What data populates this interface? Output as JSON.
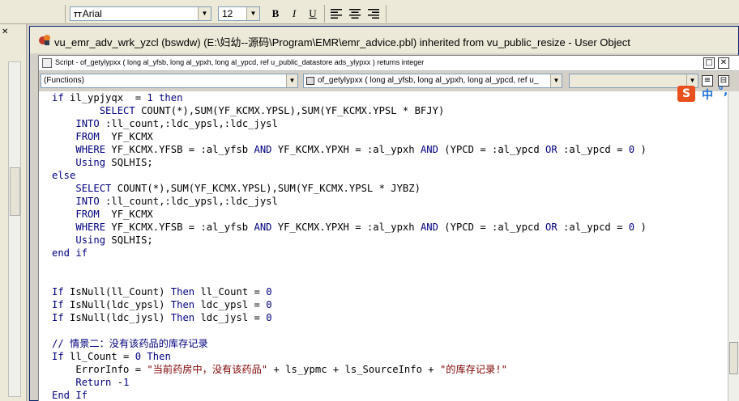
{
  "toolbar": {
    "font_icon": "TT",
    "font_name": "Arial",
    "font_size": "12",
    "bold": "B",
    "italic": "I",
    "underline": "U"
  },
  "window": {
    "title": "vu_emr_adv_wrk_yzcl (bswdw) (E:\\妇幼--源码\\Program\\EMR\\emr_advice.pbl) inherited from vu_public_resize - User Object"
  },
  "script_window": {
    "title": "Script - of_getylypxx ( long al_yfsb, long al_ypxh, long al_ypcd, ref u_public_datastore ads_ylypxx ) returns integer",
    "functions_select": "(Functions)",
    "signature_select": "of_getylypxx ( long al_yfsb, long al_ypxh, long al_ypcd, ref u_"
  },
  "ime": {
    "logo": "S",
    "label": "中"
  },
  "code_lines": [
    [
      [
        "kw",
        "if "
      ],
      [
        "t",
        "il_ypjyqx  = "
      ],
      [
        "num",
        "1"
      ],
      [
        "kw",
        " then"
      ]
    ],
    [
      [
        "t",
        "        "
      ],
      [
        "kw",
        "SELECT"
      ],
      [
        "t",
        " COUNT(*),SUM(YF_KCMX.YPSL),SUM(YF_KCMX.YPSL * BFJY)"
      ]
    ],
    [
      [
        "t",
        "    "
      ],
      [
        "kw",
        "INTO"
      ],
      [
        "t",
        " :ll_count,:ldc_ypsl,:ldc_jysl"
      ]
    ],
    [
      [
        "t",
        "    "
      ],
      [
        "kw",
        "FROM"
      ],
      [
        "t",
        "  YF_KCMX"
      ]
    ],
    [
      [
        "t",
        "    "
      ],
      [
        "kw",
        "WHERE"
      ],
      [
        "t",
        " YF_KCMX.YFSB = :al_yfsb "
      ],
      [
        "kw",
        "AND"
      ],
      [
        "t",
        " YF_KCMX.YPXH = :al_ypxh "
      ],
      [
        "kw",
        "AND"
      ],
      [
        "t",
        " (YPCD = :al_ypcd "
      ],
      [
        "kw",
        "OR"
      ],
      [
        "t",
        " :al_ypcd = "
      ],
      [
        "num",
        "0"
      ],
      [
        "t",
        " )"
      ]
    ],
    [
      [
        "t",
        "    "
      ],
      [
        "kw",
        "Using"
      ],
      [
        "t",
        " SQLHIS;"
      ]
    ],
    [
      [
        "kw",
        "else"
      ]
    ],
    [
      [
        "t",
        "    "
      ],
      [
        "kw",
        "SELECT"
      ],
      [
        "t",
        " COUNT(*),SUM(YF_KCMX.YPSL),SUM(YF_KCMX.YPSL * JYBZ)"
      ]
    ],
    [
      [
        "t",
        "    "
      ],
      [
        "kw",
        "INTO"
      ],
      [
        "t",
        " :ll_count,:ldc_ypsl,:ldc_jysl"
      ]
    ],
    [
      [
        "t",
        "    "
      ],
      [
        "kw",
        "FROM"
      ],
      [
        "t",
        "  YF_KCMX"
      ]
    ],
    [
      [
        "t",
        "    "
      ],
      [
        "kw",
        "WHERE"
      ],
      [
        "t",
        " YF_KCMX.YFSB = :al_yfsb "
      ],
      [
        "kw",
        "AND"
      ],
      [
        "t",
        " YF_KCMX.YPXH = :al_ypxh "
      ],
      [
        "kw",
        "AND"
      ],
      [
        "t",
        " (YPCD = :al_ypcd "
      ],
      [
        "kw",
        "OR"
      ],
      [
        "t",
        " :al_ypcd = "
      ],
      [
        "num",
        "0"
      ],
      [
        "t",
        " )"
      ]
    ],
    [
      [
        "t",
        "    "
      ],
      [
        "kw",
        "Using"
      ],
      [
        "t",
        " SQLHIS;"
      ]
    ],
    [
      [
        "kw",
        "end if"
      ]
    ],
    [],
    [],
    [
      [
        "kw",
        "If"
      ],
      [
        "t",
        " IsNull(ll_Count) "
      ],
      [
        "kw",
        "Then"
      ],
      [
        "t",
        " ll_Count = "
      ],
      [
        "num",
        "0"
      ]
    ],
    [
      [
        "kw",
        "If"
      ],
      [
        "t",
        " IsNull(ldc_ypsl) "
      ],
      [
        "kw",
        "Then"
      ],
      [
        "t",
        " ldc_ypsl = "
      ],
      [
        "num",
        "0"
      ]
    ],
    [
      [
        "kw",
        "If"
      ],
      [
        "t",
        " IsNull(ldc_jysl) "
      ],
      [
        "kw",
        "Then"
      ],
      [
        "t",
        " ldc_jysl = "
      ],
      [
        "num",
        "0"
      ]
    ],
    [],
    [
      [
        "cm",
        "// 情景二：没有该药品的库存记录"
      ]
    ],
    [
      [
        "kw",
        "If"
      ],
      [
        "t",
        " ll_Count = "
      ],
      [
        "num",
        "0"
      ],
      [
        "kw",
        " Then"
      ]
    ],
    [
      [
        "t",
        "    ErrorInfo = "
      ],
      [
        "str",
        "\"当前药房中，没有该药品\""
      ],
      [
        "t",
        " + ls_ypmc + ls_SourceInfo + "
      ],
      [
        "str",
        "\"的库存记录!\""
      ]
    ],
    [
      [
        "t",
        "    "
      ],
      [
        "kw",
        "Return"
      ],
      [
        "t",
        " -"
      ],
      [
        "num",
        "1"
      ]
    ],
    [
      [
        "kw",
        "End If"
      ]
    ]
  ]
}
